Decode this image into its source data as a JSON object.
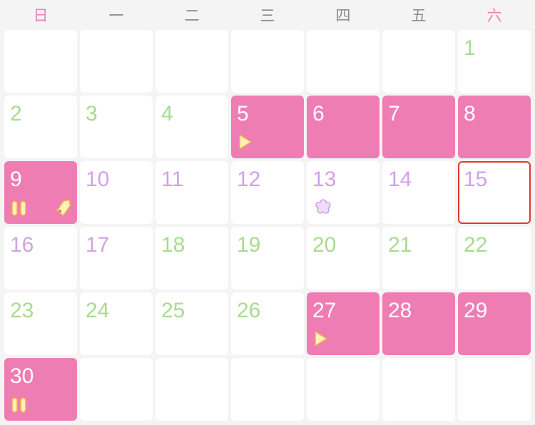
{
  "weekdays": [
    "日",
    "一",
    "二",
    "三",
    "四",
    "五",
    "六"
  ],
  "colors": {
    "period": "#ee7db4",
    "safe": "#a8dc8e",
    "fertile": "#d4a1e8",
    "today_border": "#e4372b",
    "icon_fill": "#fdf0b8",
    "icon_stroke": "#f0b040"
  },
  "leading_blanks": 6,
  "days": [
    {
      "n": "1",
      "t": "safe"
    },
    {
      "n": "2",
      "t": "safe"
    },
    {
      "n": "3",
      "t": "safe"
    },
    {
      "n": "4",
      "t": "safe"
    },
    {
      "n": "5",
      "t": "period",
      "icons": [
        "play-icon"
      ]
    },
    {
      "n": "6",
      "t": "period"
    },
    {
      "n": "7",
      "t": "period"
    },
    {
      "n": "8",
      "t": "period"
    },
    {
      "n": "9",
      "t": "period",
      "icons": [
        "pill-icon",
        "tag-icon"
      ]
    },
    {
      "n": "10",
      "t": "fertile"
    },
    {
      "n": "11",
      "t": "fertile"
    },
    {
      "n": "12",
      "t": "fertile"
    },
    {
      "n": "13",
      "t": "fertile",
      "icons": [
        "flower-icon"
      ]
    },
    {
      "n": "14",
      "t": "fertile"
    },
    {
      "n": "15",
      "t": "fertile",
      "today": true
    },
    {
      "n": "16",
      "t": "fertile"
    },
    {
      "n": "17",
      "t": "fertile"
    },
    {
      "n": "18",
      "t": "safe"
    },
    {
      "n": "19",
      "t": "safe"
    },
    {
      "n": "20",
      "t": "safe"
    },
    {
      "n": "21",
      "t": "safe"
    },
    {
      "n": "22",
      "t": "safe"
    },
    {
      "n": "23",
      "t": "safe"
    },
    {
      "n": "24",
      "t": "safe"
    },
    {
      "n": "25",
      "t": "safe"
    },
    {
      "n": "26",
      "t": "safe"
    },
    {
      "n": "27",
      "t": "period",
      "icons": [
        "play-icon"
      ]
    },
    {
      "n": "28",
      "t": "period"
    },
    {
      "n": "29",
      "t": "period"
    },
    {
      "n": "30",
      "t": "period",
      "icons": [
        "pill-icon"
      ]
    }
  ],
  "trailing_blanks": 6
}
